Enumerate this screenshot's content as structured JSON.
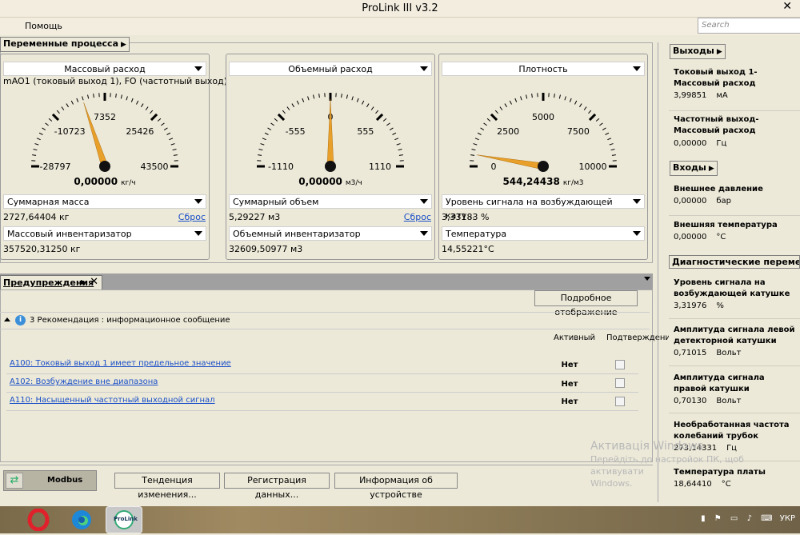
{
  "window": {
    "title": "ProLink III v3.2",
    "close": "✕"
  },
  "menu": {
    "items": [
      "Помощь"
    ]
  },
  "search": {
    "placeholder": "Search"
  },
  "process": {
    "section_label": "Переменные процесса",
    "gauges": [
      {
        "title": "Массовый расход",
        "subtitle": "mAO1 (токовый выход 1), FO (частотный выход)",
        "ticks": [
          "-28797",
          "-10723",
          "7352",
          "25426",
          "43500"
        ],
        "min": -28797,
        "max": 43500,
        "value_num": 0,
        "value": "0,00000",
        "unit": "кг/ч",
        "total_label": "Суммарная масса",
        "total_value": "2727,64404 кг",
        "reset": "Сброс",
        "inv_label": "Массовый инвентаризатор",
        "inv_value": "357520,31250 кг"
      },
      {
        "title": "Объемный расход",
        "subtitle": "",
        "ticks": [
          "-1110",
          "-555",
          "0",
          "555",
          "1110"
        ],
        "min": -1110,
        "max": 1110,
        "value_num": 0,
        "value": "0,00000",
        "unit": "м3/ч",
        "total_label": "Суммарный объем",
        "total_value": "5,29227 м3",
        "reset": "Сброс",
        "inv_label": "Объемный инвентаризатор",
        "inv_value": "32609,50977 м3"
      },
      {
        "title": "Плотность",
        "subtitle": "",
        "ticks": [
          "0",
          "2500",
          "5000",
          "7500",
          "10000"
        ],
        "min": 0,
        "max": 10000,
        "value_num": 544.24438,
        "value": "544,24438",
        "unit": "кг/м3",
        "total_label": "Уровень сигнала на возбуждающей кату...",
        "total_value": "3,33183 %",
        "reset": "",
        "inv_label": "Температура",
        "inv_value": "14,55221°C"
      }
    ]
  },
  "warnings": {
    "tab_label": "Предупреждения",
    "detail_button": "Подробное отображение",
    "group_label": "3 Рекомендация : информационное сообщение",
    "col_active": "Активный",
    "col_confirm": "Подтверждение",
    "rows": [
      {
        "text": "A100: Токовый выход 1 имеет предельное значение",
        "active": "Нет"
      },
      {
        "text": "A102: Возбуждение вне диапазона",
        "active": "Нет"
      },
      {
        "text": "A110: Насыщенный частотный выходной сигнал",
        "active": "Нет"
      }
    ]
  },
  "bottom": {
    "protocol": "Modbus",
    "buttons": [
      "Тенденция изменения...",
      "Регистрация данных...",
      "Информация об устройстве"
    ]
  },
  "side": {
    "outputs_label": "Выходы",
    "inputs_label": "Входы",
    "diag_label": "Диагностические переменные",
    "outputs": [
      {
        "name": "Токовый выход 1-Массовый расход",
        "value": "3,99851",
        "unit": "мА"
      },
      {
        "name": "Частотный выход-Массовый расход",
        "value": "0,00000",
        "unit": "Гц"
      }
    ],
    "inputs": [
      {
        "name": "Внешнее давление",
        "value": "0,00000",
        "unit": "бар"
      },
      {
        "name": "Внешняя температура",
        "value": "0,00000",
        "unit": "°C"
      }
    ],
    "diag": [
      {
        "name": "Уровень сигнала на возбуждающей катушке",
        "value": "3,31976",
        "unit": "%"
      },
      {
        "name": "Амплитуда сигнала левой детекторной катушки",
        "value": "0,71015",
        "unit": "Вольт"
      },
      {
        "name": "Амплитуда сигнала правой катушки",
        "value": "0,70130",
        "unit": "Вольт"
      },
      {
        "name": "Необработанная частота колебаний трубок",
        "value": "273,14331",
        "unit": "Гц"
      },
      {
        "name": "Температура платы",
        "value": "18,64410",
        "unit": "°C"
      }
    ]
  },
  "watermark": {
    "line1": "Активація Windows",
    "line2": "Перейдіть до настройок ПК, щоб активувати",
    "line3": "Windows."
  },
  "taskbar": {
    "lang": "УКР",
    "prolink_label": "ProLink"
  },
  "colors": {
    "needle": "#e8a02a",
    "link": "#1a4fc8",
    "panel": "#ece9d8"
  }
}
